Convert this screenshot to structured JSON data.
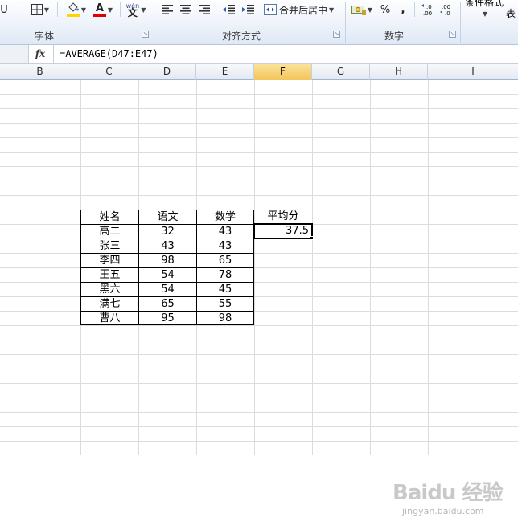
{
  "ribbon": {
    "groups": [
      {
        "label": "字体"
      },
      {
        "label": "对齐方式"
      },
      {
        "label": "数字"
      }
    ],
    "font_color_letter": "A",
    "phonetic_label": "wén",
    "phonetic_char": "文",
    "merge_center_label": "合并后居中",
    "percent_label": "%",
    "comma_label": ",",
    "cond_format_label": "条件格式",
    "table_format_label": "表",
    "accent_colors": {
      "fill": "#ffd500",
      "font": "#e00000"
    }
  },
  "formula_bar": {
    "fx_label": "fx",
    "formula": "=AVERAGE(D47:E47)"
  },
  "columns": [
    "B",
    "C",
    "D",
    "E",
    "F",
    "G",
    "H",
    "I"
  ],
  "selected_column": "F",
  "table": {
    "headers": [
      "姓名",
      "语文",
      "数学"
    ],
    "rows": [
      [
        "高二",
        "32",
        "43"
      ],
      [
        "张三",
        "43",
        "43"
      ],
      [
        "李四",
        "98",
        "65"
      ],
      [
        "王五",
        "54",
        "78"
      ],
      [
        "黑六",
        "54",
        "45"
      ],
      [
        "满七",
        "65",
        "55"
      ],
      [
        "曹八",
        "95",
        "98"
      ]
    ],
    "avg_header": "平均分",
    "avg_value": "37.5"
  },
  "watermark": {
    "logo": "Baidu 经验",
    "url": "jingyan.baidu.com"
  }
}
